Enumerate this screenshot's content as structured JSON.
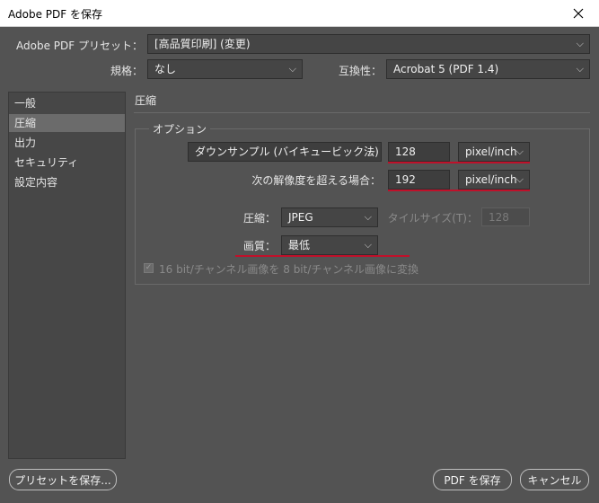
{
  "window": {
    "title": "Adobe PDF を保存",
    "close_icon": "close-icon"
  },
  "top": {
    "preset_label": "Adobe PDF プリセット：",
    "preset_value": "[高品質印刷] (変更)",
    "standard_label": "規格：",
    "standard_value": "なし",
    "compat_label": "互換性：",
    "compat_value": "Acrobat 5 (PDF 1.4)"
  },
  "sidebar": {
    "items": [
      {
        "label": "一般"
      },
      {
        "label": "圧縮"
      },
      {
        "label": "出力"
      },
      {
        "label": "セキュリティ"
      },
      {
        "label": "設定内容"
      }
    ],
    "selected": "圧縮"
  },
  "main": {
    "section_title": "圧縮",
    "group_label": "オプション",
    "downsample_value": "ダウンサンプル (バイキュービック法)",
    "resolution_value": "128",
    "resolution_unit": "pixel/inch",
    "threshold_label": "次の解像度を超える場合：",
    "threshold_value": "192",
    "threshold_unit": "pixel/inch",
    "compression_label": "圧縮：",
    "compression_value": "JPEG",
    "tile_label": "タイルサイズ(T)：",
    "tile_value": "128",
    "quality_label": "画質：",
    "quality_value": "最低",
    "convert16_label": "16 bit/チャンネル画像を 8 bit/チャンネル画像に変換",
    "convert16_checked": true
  },
  "footer": {
    "save_preset": "プリセットを保存...",
    "save_pdf": "PDF を保存",
    "cancel": "キャンセル"
  },
  "colors": {
    "annotation_underline": "#c0102a",
    "background": "#535353"
  }
}
